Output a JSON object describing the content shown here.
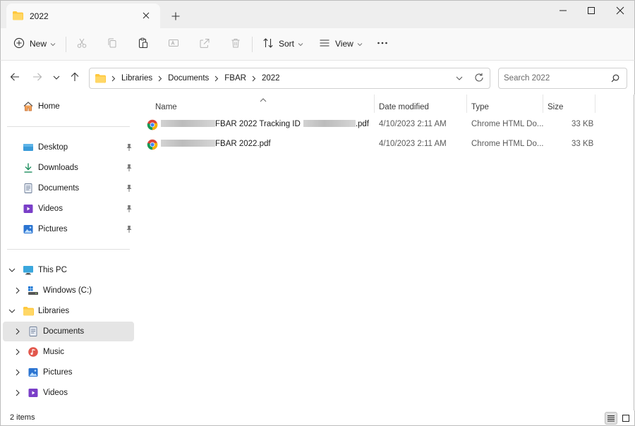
{
  "window": {
    "tab_title": "2022",
    "new_tab_symbol": "+",
    "controls": [
      "minimize-icon",
      "maximize-icon",
      "close-icon"
    ]
  },
  "toolbar": {
    "new_label": "New",
    "sort_label": "Sort",
    "view_label": "View",
    "icons": [
      "plus-circle-icon",
      "cut-icon",
      "copy-icon",
      "paste-icon",
      "rename-icon",
      "share-icon",
      "delete-icon",
      "sort-icon",
      "view-icon",
      "more-icon"
    ]
  },
  "address": {
    "breadcrumbs": [
      "Libraries",
      "Documents",
      "FBAR",
      "2022"
    ],
    "search_placeholder": "Search 2022"
  },
  "navigation": {
    "home": "Home",
    "quick_access": [
      {
        "label": "Desktop",
        "icon": "desktop-icon",
        "pinned": true
      },
      {
        "label": "Downloads",
        "icon": "downloads-icon",
        "pinned": true
      },
      {
        "label": "Documents",
        "icon": "documents-icon",
        "pinned": true
      },
      {
        "label": "Videos",
        "icon": "videos-icon",
        "pinned": true
      },
      {
        "label": "Pictures",
        "icon": "pictures-icon",
        "pinned": true
      }
    ],
    "this_pc": "This PC",
    "windows_drive": "Windows (C:)",
    "libraries": "Libraries",
    "library_items": [
      "Documents",
      "Music",
      "Pictures",
      "Videos"
    ],
    "selected": "Documents"
  },
  "columns": {
    "name": "Name",
    "date_modified": "Date modified",
    "type": "Type",
    "size": "Size"
  },
  "files": [
    {
      "name_mid": "FBAR 2022 Tracking ID",
      "name_end": ".pdf",
      "date": "4/10/2023 2:11 AM",
      "type": "Chrome HTML Do...",
      "size": "33 KB",
      "icon": "chrome-icon"
    },
    {
      "name_mid": "FBAR 2022.pdf",
      "name_end": "",
      "date": "4/10/2023 2:11 AM",
      "type": "Chrome HTML Do...",
      "size": "33 KB",
      "icon": "chrome-icon"
    }
  ],
  "status": {
    "item_count": "2 items"
  },
  "colors": {
    "accent": "#0067c0",
    "folder": "#ffc83d",
    "selection": "#e5e5e5"
  }
}
